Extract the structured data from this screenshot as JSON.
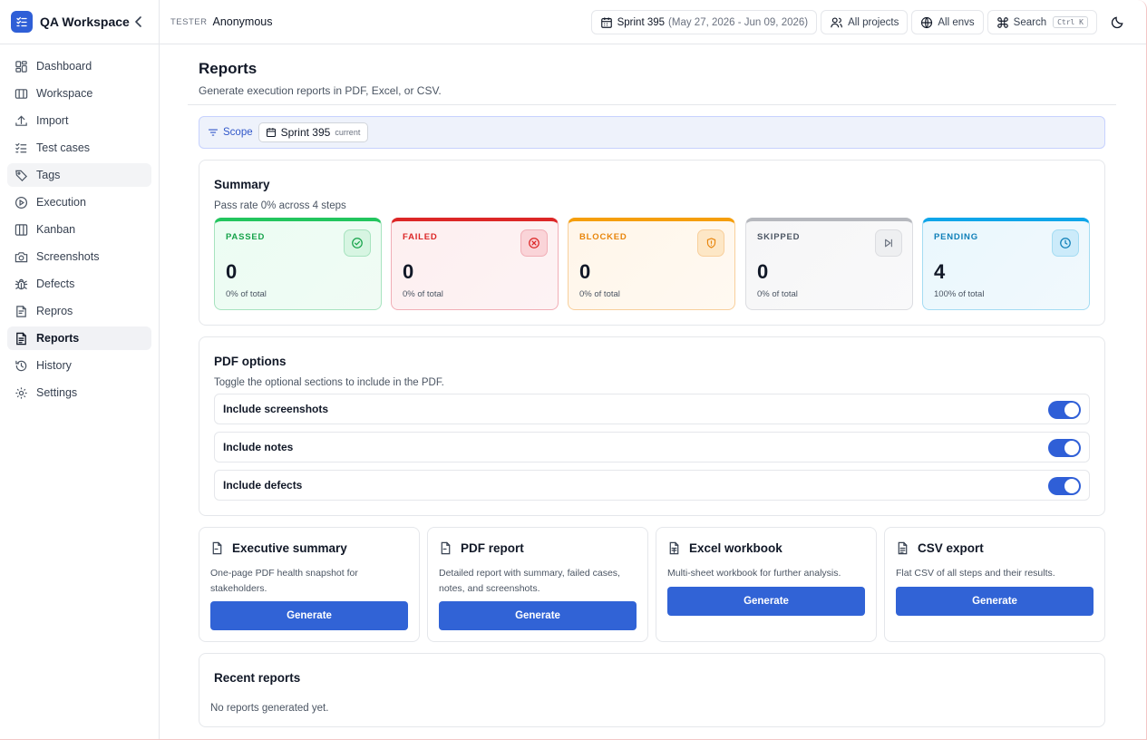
{
  "app": {
    "name": "QA Workspace"
  },
  "sidebar": {
    "items": [
      {
        "label": "Dashboard",
        "icon": "dashboard-icon"
      },
      {
        "label": "Workspace",
        "icon": "workspace-icon"
      },
      {
        "label": "Import",
        "icon": "upload-icon"
      },
      {
        "label": "Test cases",
        "icon": "checklist-icon"
      },
      {
        "label": "Tags",
        "icon": "tag-icon"
      },
      {
        "label": "Execution",
        "icon": "play-icon"
      },
      {
        "label": "Kanban",
        "icon": "kanban-icon"
      },
      {
        "label": "Screenshots",
        "icon": "camera-icon"
      },
      {
        "label": "Defects",
        "icon": "bug-icon"
      },
      {
        "label": "Repros",
        "icon": "repro-icon"
      },
      {
        "label": "Reports",
        "icon": "report-icon"
      },
      {
        "label": "History",
        "icon": "history-icon"
      },
      {
        "label": "Settings",
        "icon": "gear-icon"
      }
    ]
  },
  "header": {
    "tester_label": "TESTER",
    "tester_name": "Anonymous",
    "sprint_label": "Sprint 395",
    "sprint_range": "(May 27, 2026 - Jun 09, 2026)",
    "projects_label": "All projects",
    "envs_label": "All envs",
    "search_label": "Search",
    "search_shortcut": "Ctrl K"
  },
  "page": {
    "title": "Reports",
    "subtitle": "Generate execution reports in PDF, Excel, or CSV."
  },
  "scope": {
    "label": "Scope",
    "sprint": "Sprint 395",
    "tag": "current"
  },
  "summary": {
    "title": "Summary",
    "subtitle": "Pass rate 0% across 4 steps",
    "stats": [
      {
        "label": "PASSED",
        "value": "0",
        "pct": "0% of total",
        "color": "#16a34a"
      },
      {
        "label": "FAILED",
        "value": "0",
        "pct": "0% of total",
        "color": "#dc2626"
      },
      {
        "label": "BLOCKED",
        "value": "0",
        "pct": "0% of total",
        "color": "#ea8a0b"
      },
      {
        "label": "SKIPPED",
        "value": "0",
        "pct": "0% of total",
        "color": "#6b7280"
      },
      {
        "label": "PENDING",
        "value": "4",
        "pct": "100% of total",
        "color": "#0e7fb8"
      }
    ]
  },
  "pdf_options": {
    "title": "PDF options",
    "subtitle": "Toggle the optional sections to include in the PDF.",
    "options": [
      {
        "label": "Include screenshots",
        "enabled": true
      },
      {
        "label": "Include notes",
        "enabled": true
      },
      {
        "label": "Include defects",
        "enabled": true
      }
    ]
  },
  "generators": [
    {
      "title": "Executive summary",
      "description": "One-page PDF health snapshot for stakeholders.",
      "button": "Generate"
    },
    {
      "title": "PDF report",
      "description": "Detailed report with summary, failed cases, notes, and screenshots.",
      "button": "Generate"
    },
    {
      "title": "Excel workbook",
      "description": "Multi-sheet workbook for further analysis.",
      "button": "Generate"
    },
    {
      "title": "CSV export",
      "description": "Flat CSV of all steps and their results.",
      "button": "Generate"
    }
  ],
  "recent": {
    "title": "Recent reports",
    "empty": "No reports generated yet."
  },
  "colors": {
    "accent": "#2f5fd7",
    "button": "#3163d6"
  }
}
